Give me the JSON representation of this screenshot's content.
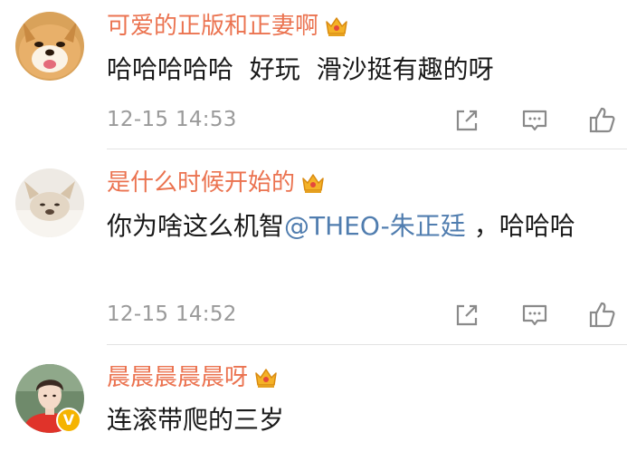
{
  "comments": [
    {
      "username": "可爱的正版和正妻啊",
      "text": "哈哈哈哈哈  好玩  滑沙挺有趣的呀",
      "timestamp": "12-15 14:53",
      "avatar": "shiba-inu-dog-avatar"
    },
    {
      "username": "是什么时候开始的",
      "text_before": "你为啥这么机智",
      "mention": "@THEO-朱正廷",
      "text_after": " ，哈哈哈",
      "timestamp": "12-15 14:52",
      "avatar": "french-bulldog-avatar"
    },
    {
      "username": "晨晨晨晨晨呀",
      "text": "连滚带爬的三岁",
      "avatar": "young-man-avatar",
      "verified_badge": "V"
    }
  ],
  "icons": {
    "member_badge": "crown-icon",
    "share": "share-icon",
    "reply": "comment-icon",
    "like": "thumbs-up-icon"
  },
  "colors": {
    "username": "#eb7350",
    "mention": "#507daf",
    "timestamp": "#9a9a9a",
    "icon": "#8a8a8a",
    "crown": "#f4b227",
    "verified": "#f5b400"
  }
}
